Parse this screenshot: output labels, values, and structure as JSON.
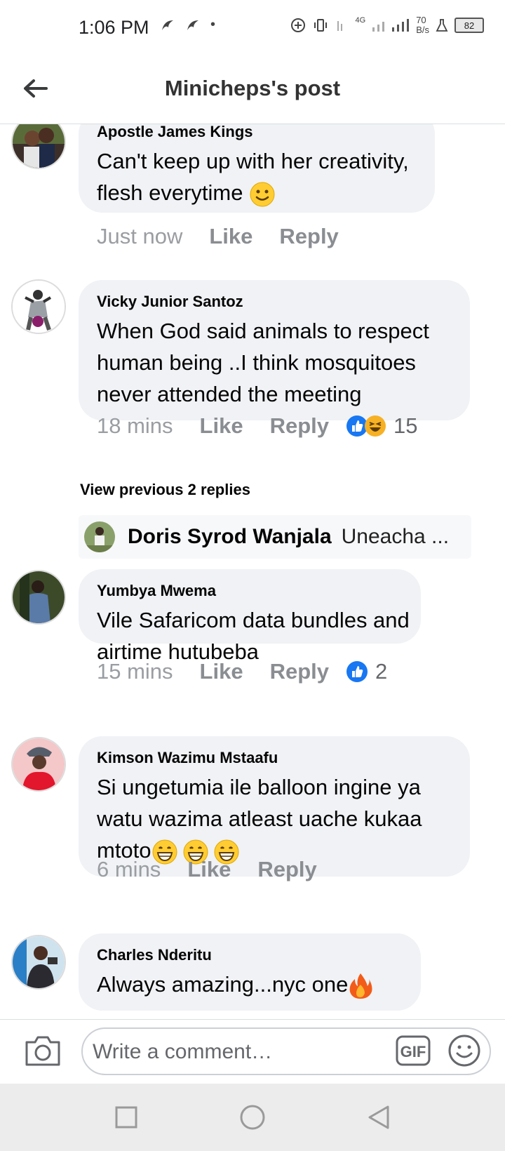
{
  "status_bar": {
    "time": "1:06 PM",
    "network": "4G",
    "speed_value": "70",
    "speed_unit": "B/s",
    "battery": "82"
  },
  "header": {
    "title": "Minicheps's post"
  },
  "comments": [
    {
      "author": "Apostle James Kings",
      "text": "Can't keep up with her creativity, flesh  everytime",
      "emoji": "slightly-smiling-face",
      "time": "Just now",
      "like": "Like",
      "reply": "Reply"
    },
    {
      "author": "Vicky Junior Santoz",
      "text": "When God said animals to respect human being ..I think mosquitoes never attended the meeting",
      "time": "18 mins",
      "like": "Like",
      "reply": "Reply",
      "reaction_icons": [
        "like-icon",
        "haha-icon"
      ],
      "reaction_count": "15"
    },
    {
      "author": "Yumbya Mwema",
      "text": "Vile Safaricom data bundles and airtime hutubeba",
      "time": "15 mins",
      "like": "Like",
      "reply": "Reply",
      "reaction_icons": [
        "like-icon"
      ],
      "reaction_count": "2"
    },
    {
      "author": "Kimson Wazimu Mstaafu",
      "text": "Si ungetumia ile balloon ingine ya watu wazima atleast uache kukaa mtoto",
      "emoji": "grinning-face x3",
      "time": "6 mins",
      "like": "Like",
      "reply": "Reply"
    },
    {
      "author": "Charles Nderitu",
      "text": "Always amazing...nyc one",
      "emoji": "fire"
    }
  ],
  "view_previous": "View previous 2 replies",
  "reply_preview": {
    "author": "Doris Syrod Wanjala",
    "text": "Uneacha ..."
  },
  "composer": {
    "placeholder": "Write a comment…",
    "gif_label": "GIF"
  },
  "colors": {
    "bubble_bg": "#f0f2f5",
    "like_blue": "#1877f2",
    "meta_gray": "#8a8d91"
  }
}
